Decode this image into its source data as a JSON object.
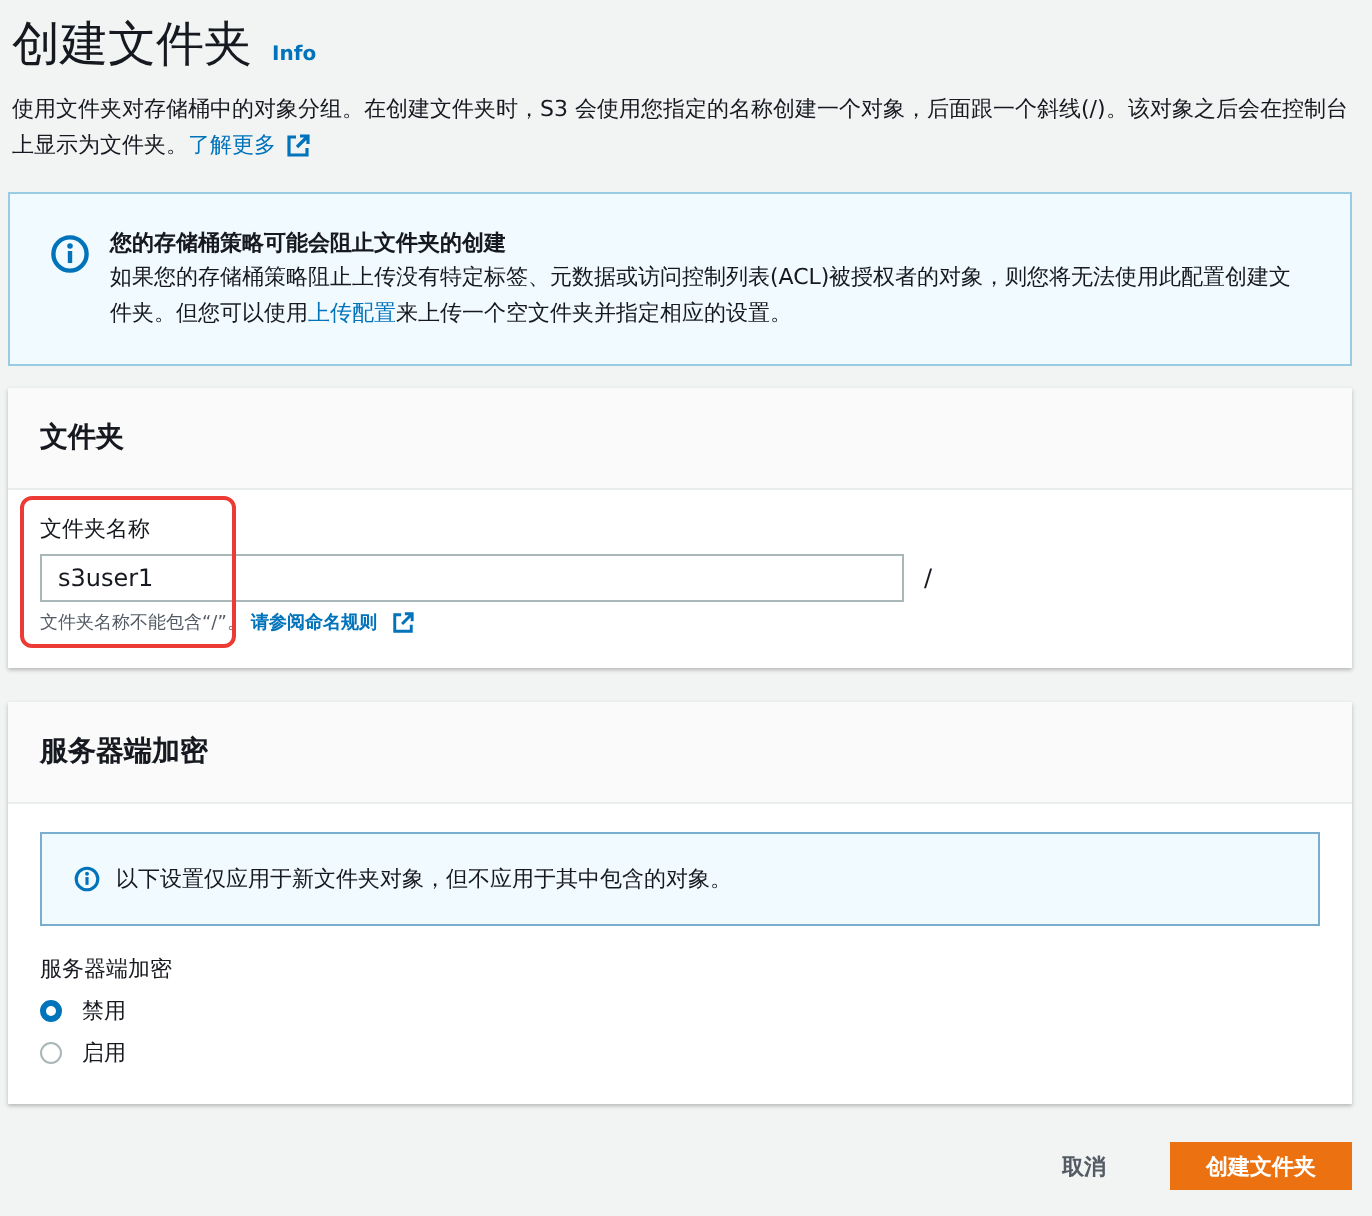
{
  "header": {
    "title": "创建文件夹",
    "info_link": "Info",
    "description": "使用文件夹对存储桶中的对象分组。在创建文件夹时，S3 会使用您指定的名称创建一个对象，后面跟一个斜线(/)。该对象之后会在控制台上显示为文件夹。",
    "learn_more": "了解更多"
  },
  "policy_alert": {
    "title": "您的存储桶策略可能会阻止文件夹的创建",
    "text_before": "如果您的存储桶策略阻止上传没有特定标签、元数据或访问控制列表(ACL)被授权者的对象，则您将无法使用此配置创建文件夹。但您可以使用",
    "link": "上传配置",
    "text_after": "来上传一个空文件夹并指定相应的设置。"
  },
  "folder_section": {
    "title": "文件夹",
    "field_label": "文件夹名称",
    "value": "s3user1",
    "suffix": "/",
    "hint": "文件夹名称不能包含“/”。",
    "hint_link": "请参阅命名规则",
    "highlighted": true
  },
  "encryption_section": {
    "title": "服务器端加密",
    "note": "以下设置仅应用于新文件夹对象，但不应用于其中包含的对象。",
    "group_label": "服务器端加密",
    "options": [
      {
        "label": "禁用",
        "selected": true
      },
      {
        "label": "启用",
        "selected": false
      }
    ]
  },
  "actions": {
    "cancel": "取消",
    "submit": "创建文件夹"
  }
}
